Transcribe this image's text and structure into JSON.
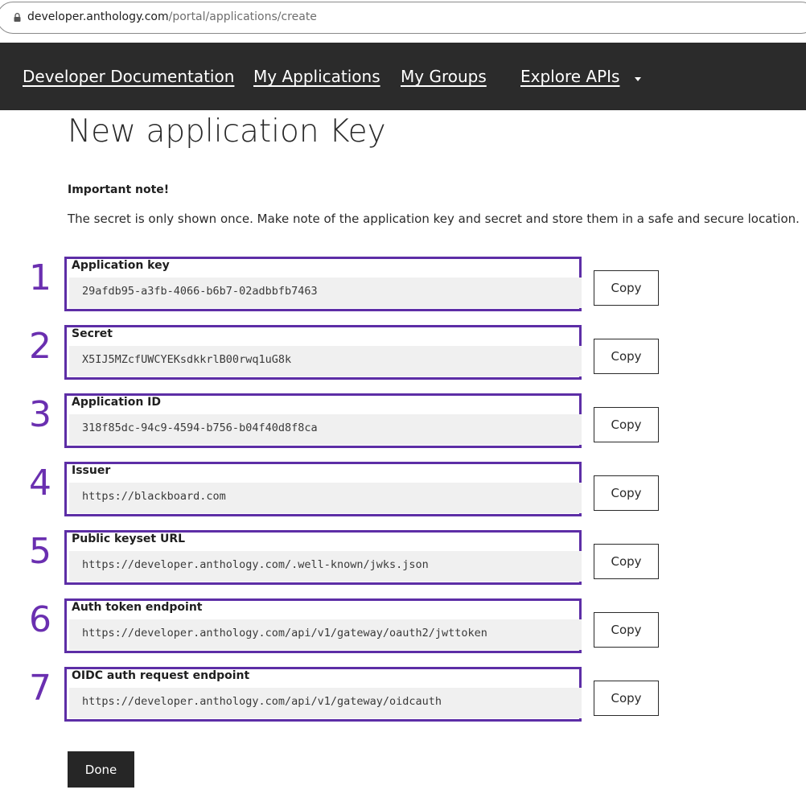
{
  "browser": {
    "url_domain": "developer.anthology.com",
    "url_path": "/portal/applications/create",
    "lock_icon": "lock-icon"
  },
  "nav": {
    "items": [
      {
        "label": "Developer Documentation"
      },
      {
        "label": "My Applications"
      },
      {
        "label": "My Groups"
      },
      {
        "label": "Explore APIs"
      }
    ],
    "dropdown_icon": "caret-down-icon"
  },
  "page": {
    "title": "New application Key",
    "note_heading": "Important note!",
    "note_text": "The secret is only shown once. Make note of the application key and secret and store them in a safe and secure location."
  },
  "fields": [
    {
      "number": "1",
      "label": "Application key",
      "value": "29afdb95-a3fb-4066-b6b7-02adbbfb7463",
      "copy_label": "Copy"
    },
    {
      "number": "2",
      "label": "Secret",
      "value": "X5IJ5MZcfUWCYEKsdkkrlB00rwq1uG8k",
      "copy_label": "Copy"
    },
    {
      "number": "3",
      "label": "Application ID",
      "value": "318f85dc-94c9-4594-b756-b04f40d8f8ca",
      "copy_label": "Copy"
    },
    {
      "number": "4",
      "label": "Issuer",
      "value": "https://blackboard.com",
      "copy_label": "Copy"
    },
    {
      "number": "5",
      "label": "Public keyset URL",
      "value": "https://developer.anthology.com/.well-known/jwks.json",
      "copy_label": "Copy"
    },
    {
      "number": "6",
      "label": "Auth token endpoint",
      "value": "https://developer.anthology.com/api/v1/gateway/oauth2/jwttoken",
      "copy_label": "Copy"
    },
    {
      "number": "7",
      "label": "OIDC auth request endpoint",
      "value": "https://developer.anthology.com/api/v1/gateway/oidcauth",
      "copy_label": "Copy"
    }
  ],
  "actions": {
    "done_label": "Done"
  },
  "colors": {
    "nav_background": "#2b2b2b",
    "highlight_border": "#5d2ea6",
    "annotation_number": "#6a2fb0",
    "done_button": "#262626"
  }
}
